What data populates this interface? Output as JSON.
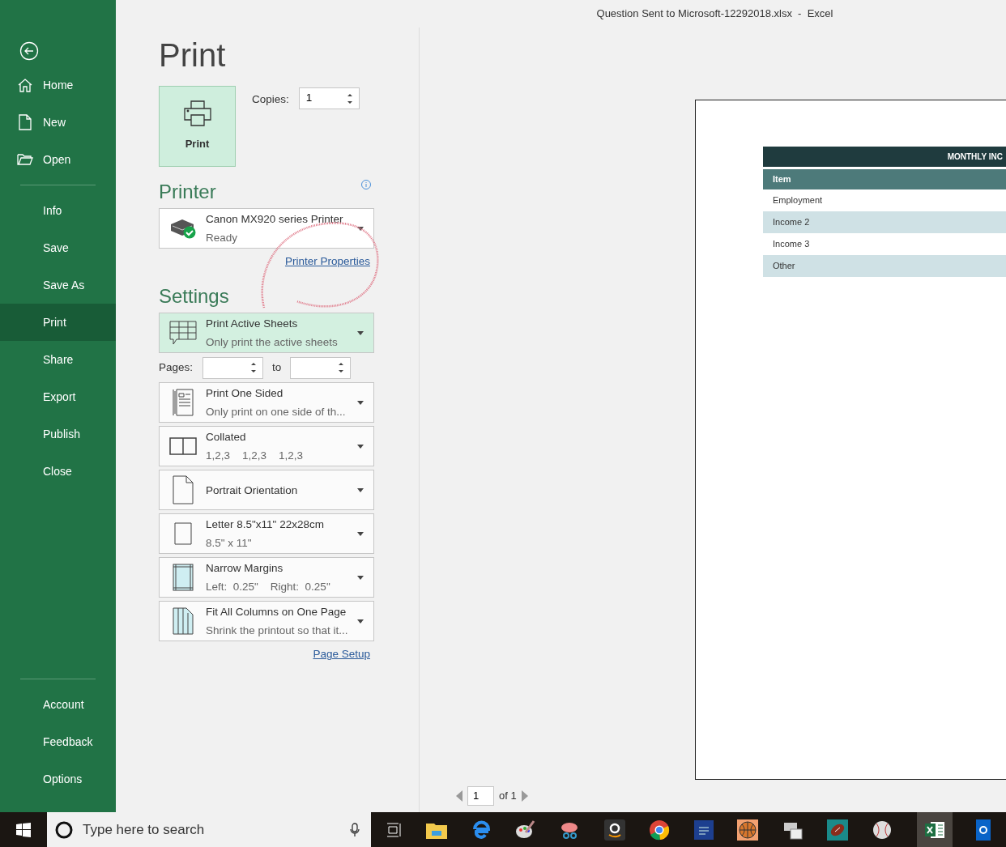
{
  "window": {
    "title": "Question Sent to Microsoft-12292018.xlsx  -  Excel"
  },
  "sidebar": {
    "top_items": [
      {
        "label": "Home",
        "selected": false
      },
      {
        "label": "New",
        "selected": false
      },
      {
        "label": "Open",
        "selected": false
      }
    ],
    "items": [
      {
        "label": "Info",
        "selected": false
      },
      {
        "label": "Save",
        "selected": false
      },
      {
        "label": "Save As",
        "selected": false
      },
      {
        "label": "Print",
        "selected": true
      },
      {
        "label": "Share",
        "selected": false
      },
      {
        "label": "Export",
        "selected": false
      },
      {
        "label": "Publish",
        "selected": false
      },
      {
        "label": "Close",
        "selected": false
      }
    ],
    "bottom_items": [
      {
        "label": "Account",
        "selected": false
      },
      {
        "label": "Feedback",
        "selected": false
      },
      {
        "label": "Options",
        "selected": false
      }
    ]
  },
  "print": {
    "heading": "Print",
    "button": "Print",
    "copies": {
      "label": "Copies:",
      "value": "1"
    }
  },
  "printer": {
    "heading": "Printer",
    "name": "Canon MX920 series Printer",
    "status": "Ready",
    "link": "Printer Properties"
  },
  "settings": {
    "heading": "Settings",
    "scope": {
      "title": "Print Active Sheets",
      "subtitle": "Only print the active sheets",
      "selected": true
    },
    "pages": {
      "label": "Pages:",
      "to": "to"
    },
    "options": [
      {
        "title": "Print One Sided",
        "subtitle": "Only print on one side of th..."
      },
      {
        "title": "Collated",
        "subtitle": "1,2,3    1,2,3    1,2,3"
      },
      {
        "title": "Portrait Orientation"
      },
      {
        "title": "Letter 8.5\"x11\" 22x28cm",
        "subtitle": "8.5\" x 11\""
      },
      {
        "title": "Narrow Margins",
        "subtitle": "Left:  0.25\"    Right:  0.25\""
      },
      {
        "title": "Fit All Columns on One Page",
        "subtitle": "Shrink the printout so that it..."
      }
    ],
    "link": "Page Setup"
  },
  "preview": {
    "table_title": "MONTHLY INC",
    "header": "Item",
    "rows": [
      "Employment",
      "Income 2",
      "Income 3",
      "Other"
    ],
    "page_nav": {
      "page": "1",
      "of": "of 1"
    }
  },
  "taskbar": {
    "search_placeholder": "Type here to search"
  }
}
